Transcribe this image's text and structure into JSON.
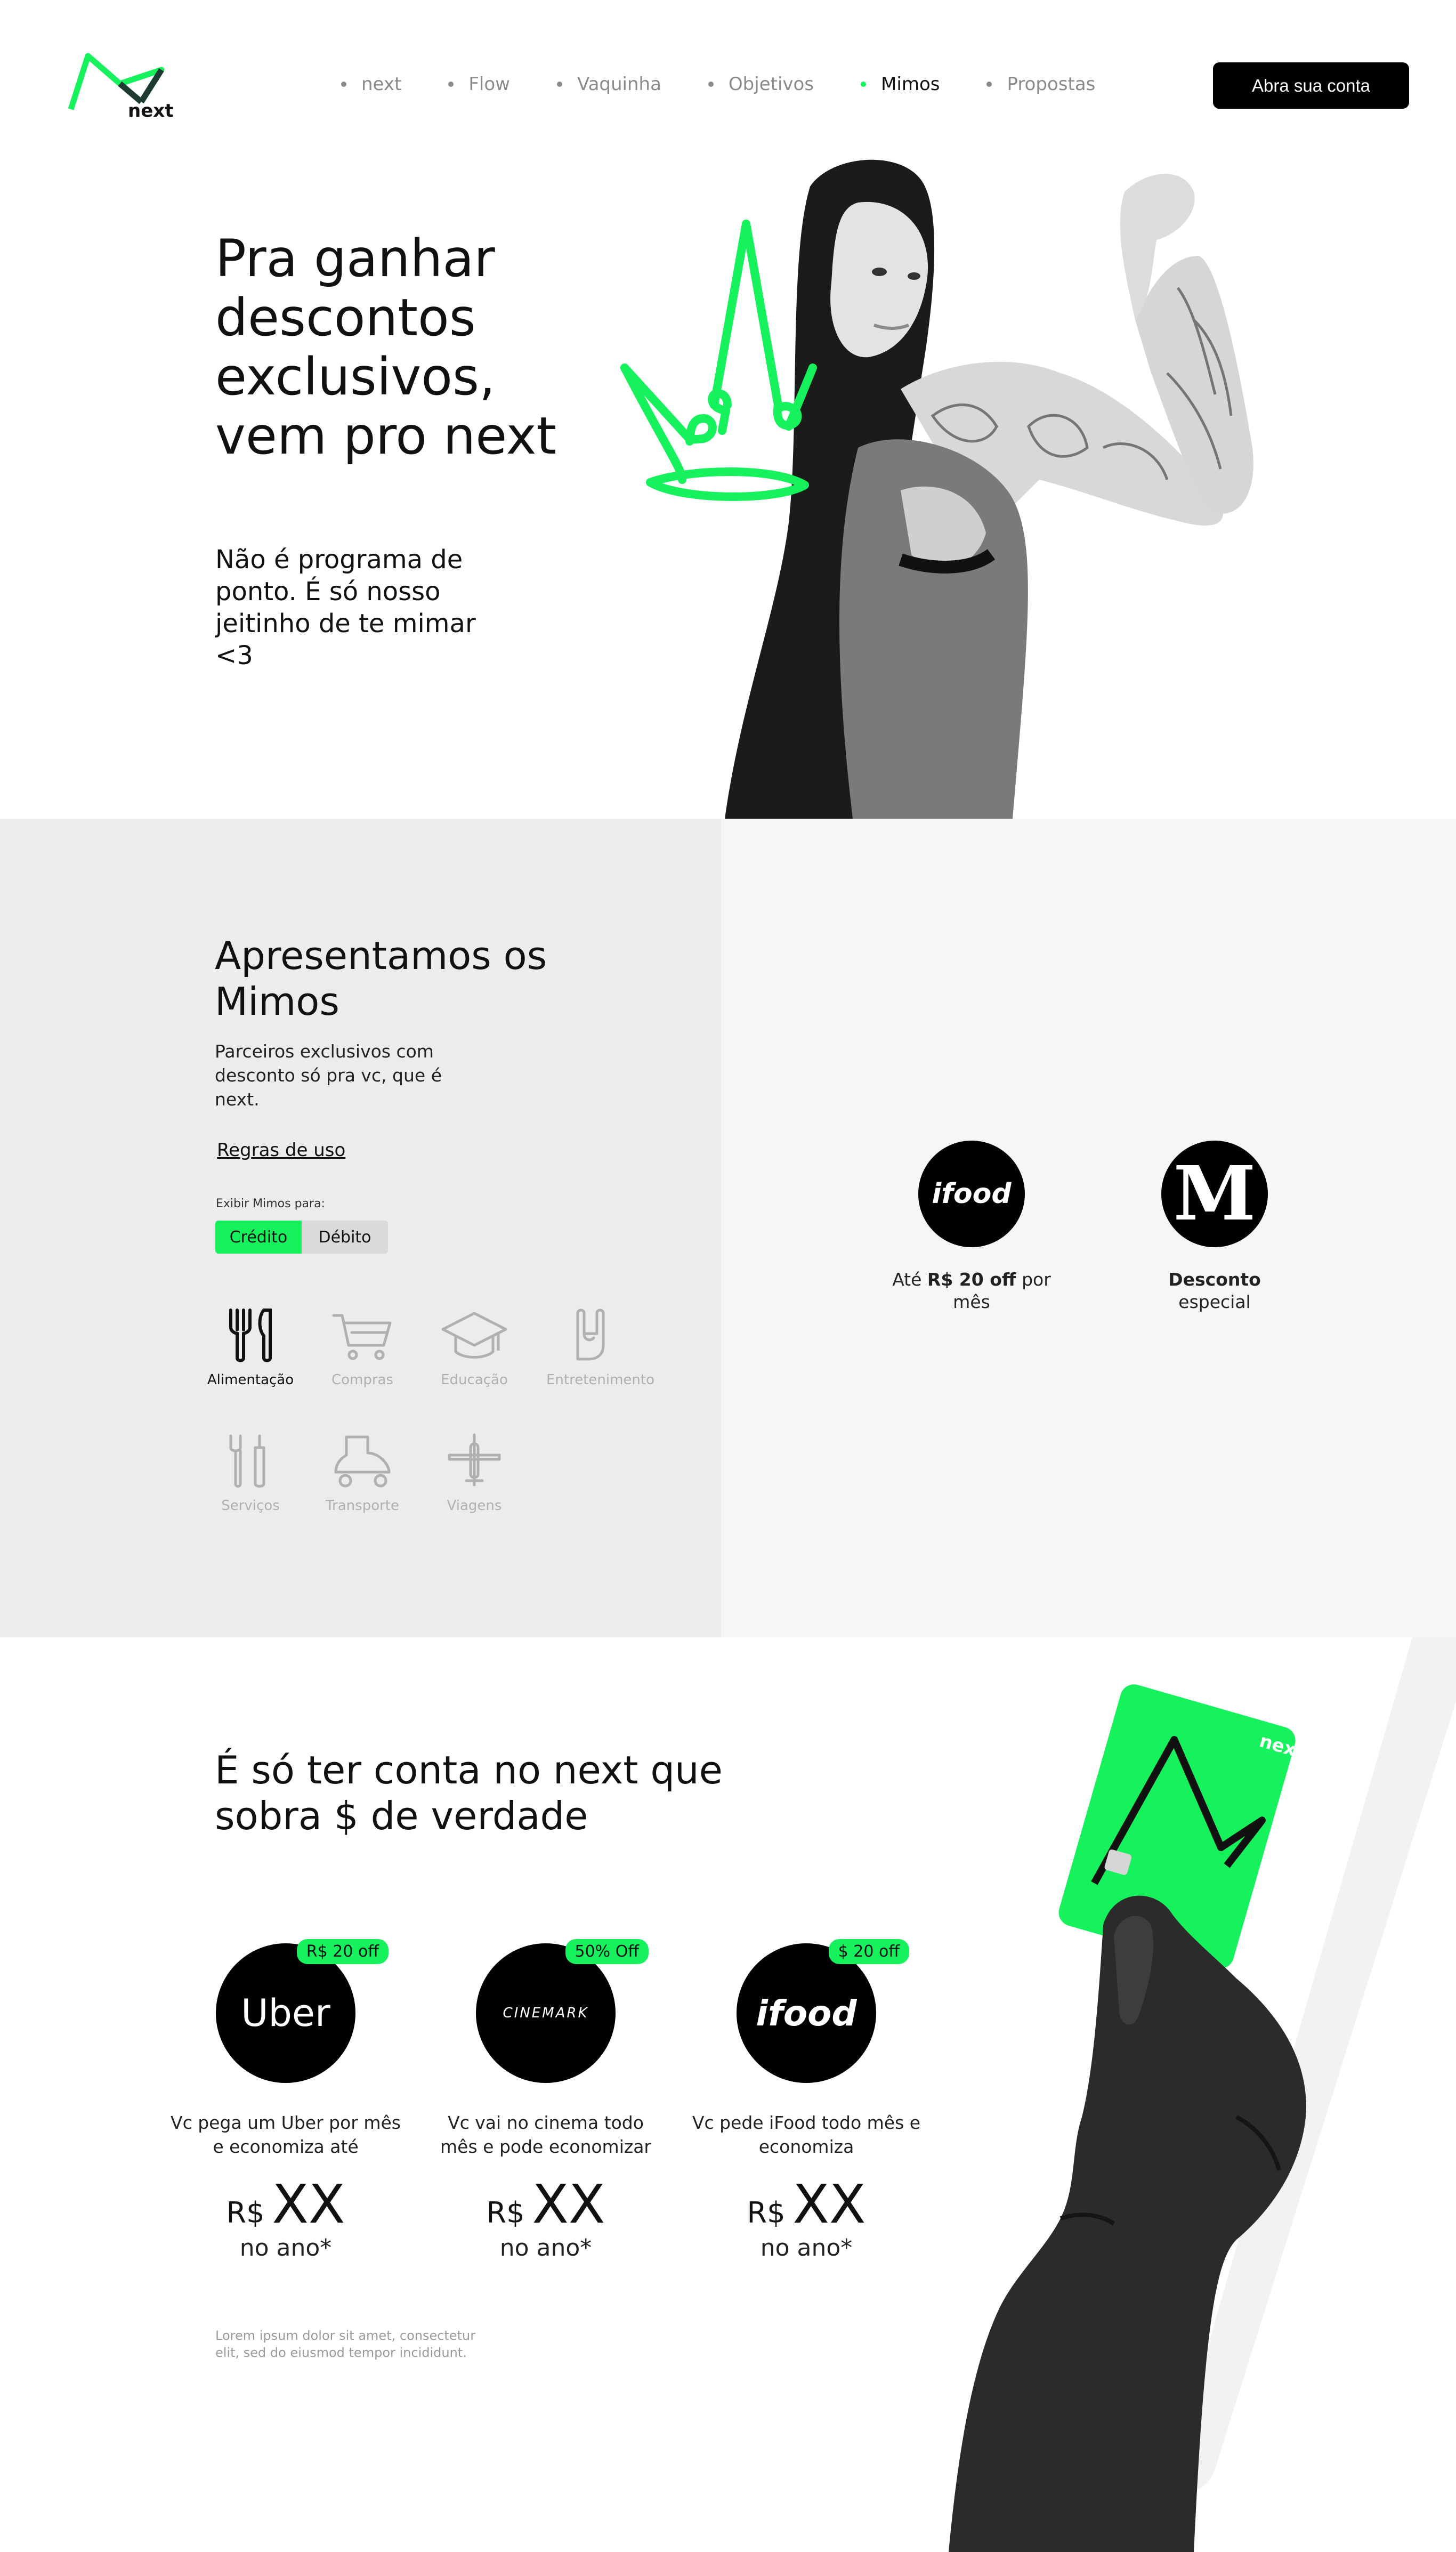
{
  "header": {
    "logo_text": "next",
    "nav": [
      {
        "label": "next",
        "active": false
      },
      {
        "label": "Flow",
        "active": false
      },
      {
        "label": "Vaquinha",
        "active": false
      },
      {
        "label": "Objetivos",
        "active": false
      },
      {
        "label": "Mimos",
        "active": true
      },
      {
        "label": "Propostas",
        "active": false
      }
    ],
    "cta_label": "Abra sua conta"
  },
  "hero": {
    "title": "Pra ganhar descontos exclusivos, vem pro next",
    "subtitle": "Não é programa de ponto. É só nosso jeitinho de te mimar <3"
  },
  "mimos": {
    "title": "Apresentamos os Mimos",
    "description": "Parceiros exclusivos com desconto só pra vc, que é next.",
    "rules_link": "Regras de uso",
    "toggle_label": "Exibir Mimos para:",
    "toggle": {
      "credit": "Crédito",
      "debit": "Débito",
      "selected": "Crédito"
    },
    "categories": [
      {
        "label": "Alimentação",
        "icon": "cutlery-icon",
        "active": true
      },
      {
        "label": "Compras",
        "icon": "cart-icon",
        "active": false
      },
      {
        "label": "Educação",
        "icon": "graduation-cap-icon",
        "active": false
      },
      {
        "label": "Entretenimento",
        "icon": "rock-hand-icon",
        "active": false
      },
      {
        "label": "Serviços",
        "icon": "tools-icon",
        "active": false
      },
      {
        "label": "Transporte",
        "icon": "scooter-icon",
        "active": false
      },
      {
        "label": "Viagens",
        "icon": "airplane-icon",
        "active": false
      }
    ],
    "partners": [
      {
        "logo": "ifood",
        "text_pre": "Até ",
        "text_bold": "R$ 20 off",
        "text_post": " por mês"
      },
      {
        "logo": "M",
        "text_bold": "Desconto",
        "text_post": "especial"
      }
    ]
  },
  "savings": {
    "title": "É só ter conta no next que sobra $ de verdade",
    "offers": [
      {
        "logo": "Uber",
        "badge": "R$ 20 off",
        "desc": "Vc pega um Uber por mês e economiza até",
        "currency": "R$",
        "amount": "XX",
        "per": "no ano*"
      },
      {
        "logo": "CINEMARK",
        "badge": "50% Off",
        "desc": "Vc vai no cinema todo mês e pode economizar",
        "currency": "R$",
        "amount": "XX",
        "per": "no ano*"
      },
      {
        "logo": "ifood",
        "badge": "$ 20 off",
        "desc": "Vc pede iFood todo mês e economiza",
        "currency": "R$",
        "amount": "XX",
        "per": "no ano*"
      }
    ],
    "disclaimer": "Lorem ipsum dolor sit amet, consectetur elit, sed do eiusmod tempor incididunt.",
    "card_brand": "next"
  },
  "colors": {
    "accent": "#16f25c",
    "dark": "#000000",
    "panel_left": "#ececec",
    "panel_right": "#f6f6f6"
  }
}
